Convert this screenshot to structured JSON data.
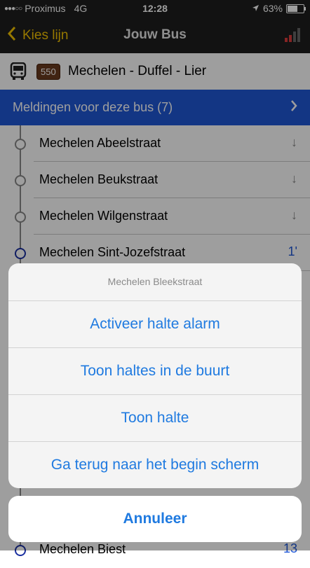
{
  "statusbar": {
    "carrier": "Proximus",
    "network": "4G",
    "time": "12:28",
    "battery_percent": "63%",
    "battery_level": 0.63
  },
  "navbar": {
    "back_label": "Kies lijn",
    "title": "Jouw Bus",
    "accent_color": "#f2c200"
  },
  "route": {
    "number": "550",
    "name": "Mechelen - Duffel - Lier"
  },
  "alerts": {
    "label": "Meldingen voor deze bus (7)",
    "color": "#1f57d6"
  },
  "stops": [
    {
      "name": "Mechelen Abeelstraat",
      "right": "↓"
    },
    {
      "name": "Mechelen Beukstraat",
      "right": "↓"
    },
    {
      "name": "Mechelen Wilgenstraat",
      "right": "↓"
    },
    {
      "name": "Mechelen Sint-Jozefstraat",
      "right": "1'"
    },
    {
      "name": "Mechelen Biest",
      "right": "13"
    }
  ],
  "action_sheet": {
    "title": "Mechelen Bleekstraat",
    "actions": [
      "Activeer halte alarm",
      "Toon haltes in de buurt",
      "Toon halte",
      "Ga terug naar het begin scherm"
    ],
    "cancel_label": "Annuleer"
  }
}
